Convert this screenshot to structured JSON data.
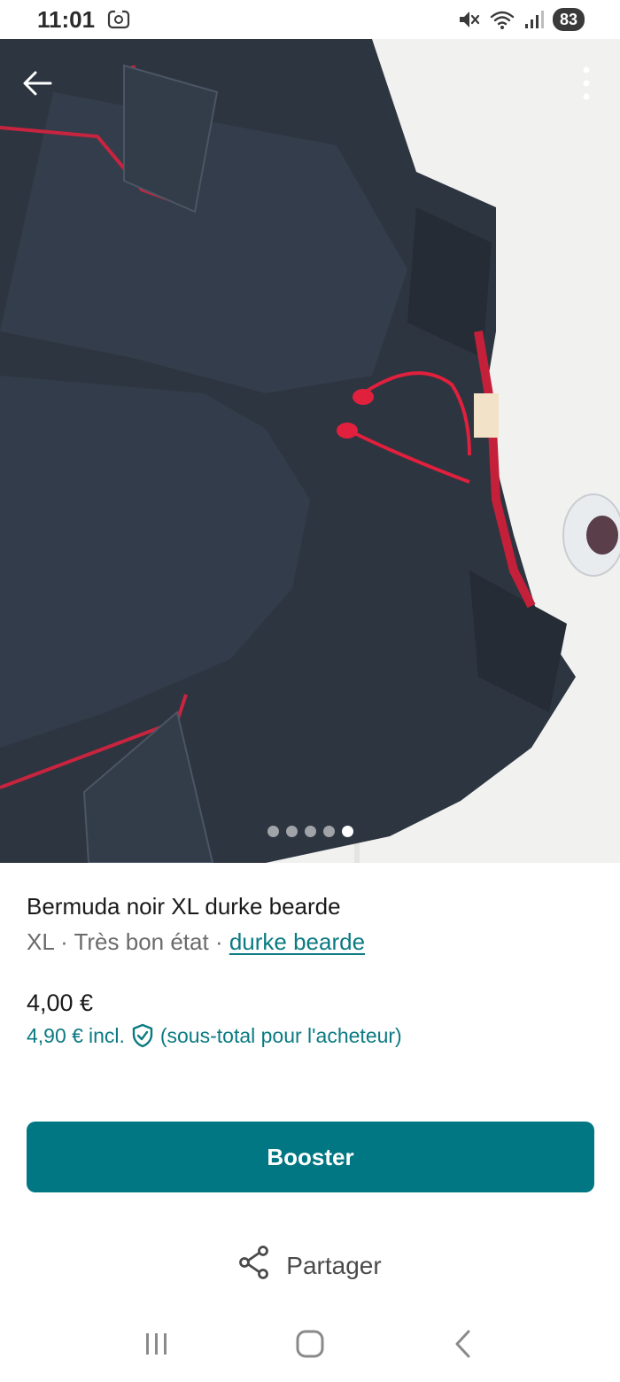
{
  "status_bar": {
    "time": "11:01",
    "battery": "83",
    "icons": [
      "screenshot-icon",
      "mute-icon",
      "wifi-icon",
      "signal-icon"
    ]
  },
  "top_actions": {
    "back_icon": "arrow-left-icon",
    "more_icon": "more-vertical-icon"
  },
  "gallery": {
    "count": 5,
    "active_index": 4
  },
  "listing": {
    "title": "Bermuda noir XL durke bearde",
    "size": "XL",
    "separator": " · ",
    "condition": "Très bon état",
    "brand": "durke bearde",
    "price": "4,00 €",
    "price_incl_amount": "4,90 €",
    "price_incl_label": "incl.",
    "price_incl_note": "(sous-total pour l'acheteur)"
  },
  "actions": {
    "boost_label": "Booster",
    "share_label": "Partager"
  },
  "nav": {
    "items": [
      "recent-apps-icon",
      "home-icon",
      "back-icon"
    ]
  },
  "colors": {
    "accent": "#007782",
    "link": "#0b7a82"
  }
}
